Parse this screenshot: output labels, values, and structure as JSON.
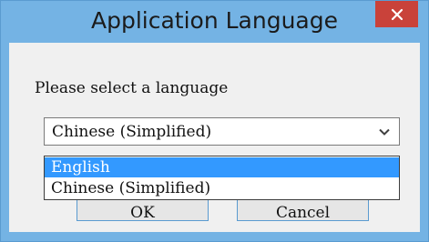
{
  "window": {
    "title": "Application Language"
  },
  "dialog": {
    "prompt": "Please select a language",
    "combo_value": "Chinese (Simplified)",
    "options": [
      "English",
      "Chinese (Simplified)"
    ],
    "ok_label": "OK",
    "cancel_label": "Cancel"
  },
  "colors": {
    "frame": "#74b3e4",
    "close": "#c9423a",
    "highlight": "#3399ff"
  }
}
